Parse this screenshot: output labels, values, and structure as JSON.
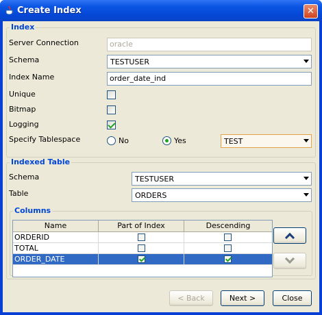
{
  "window": {
    "title": "Create Index",
    "close_glyph": "✕"
  },
  "index_group": {
    "title": "Index",
    "server_connection": {
      "label": "Server Connection",
      "value": "oracle"
    },
    "schema": {
      "label": "Schema",
      "value": "TESTUSER"
    },
    "index_name": {
      "label": "Index Name",
      "value": "order_date_ind"
    },
    "unique": {
      "label": "Unique",
      "checked": false
    },
    "bitmap": {
      "label": "Bitmap",
      "checked": false
    },
    "logging": {
      "label": "Logging",
      "checked": true
    },
    "tablespace": {
      "label": "Specify Tablespace",
      "no_label": "No",
      "yes_label": "Yes",
      "selected": "Yes",
      "value": "TEST"
    }
  },
  "indexed_table_group": {
    "title": "Indexed Table",
    "schema": {
      "label": "Schema",
      "value": "TESTUSER"
    },
    "table": {
      "label": "Table",
      "value": "ORDERS"
    }
  },
  "columns_group": {
    "title": "Columns",
    "headers": [
      "Name",
      "Part of Index",
      "Descending"
    ],
    "rows": [
      {
        "name": "ORDERID",
        "part_of_index": false,
        "descending": false,
        "selected": false
      },
      {
        "name": "TOTAL",
        "part_of_index": false,
        "descending": false,
        "selected": false
      },
      {
        "name": "ORDER_DATE",
        "part_of_index": true,
        "descending": true,
        "selected": true
      }
    ]
  },
  "footer": {
    "back_label": "< Back",
    "next_label": "Next >",
    "close_label": "Close"
  },
  "colors": {
    "accent": "#0046d5",
    "selection": "#316ac5",
    "check": "#21a121",
    "title_bar": "#0b56e4"
  }
}
